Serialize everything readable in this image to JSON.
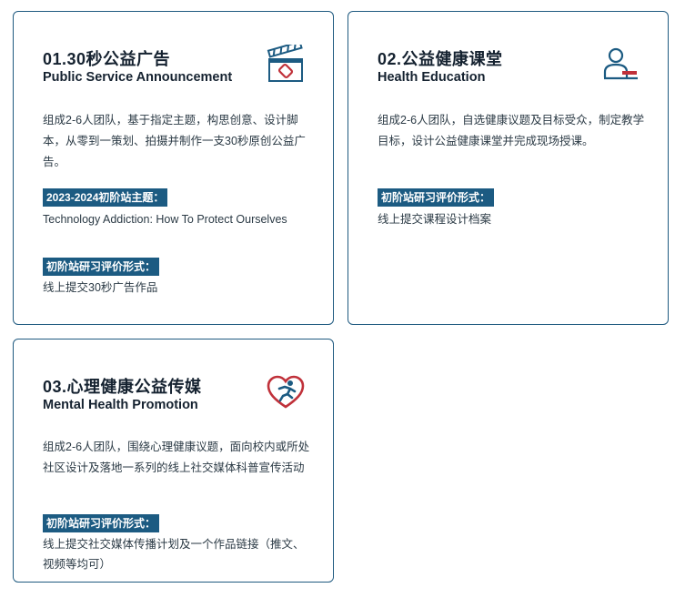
{
  "cards": [
    {
      "title_zh": "01.30秒公益广告",
      "title_en": "Public Service Announcement",
      "icon": "clapperboard-icon",
      "description": "组成2-6人团队，基于指定主题，构思创意、设计脚本，从零到一策划、拍摄并制作一支30秒原创公益广告。",
      "theme_label": "2023-2024初阶站主题：",
      "theme_text": "Technology Addiction: How To Protect Ourselves",
      "eval_label": "初阶站研习评价形式：",
      "eval_text": "线上提交30秒广告作品"
    },
    {
      "title_zh": "02.公益健康课堂",
      "title_en": "Health Education",
      "icon": "lecturer-icon",
      "description": "组成2-6人团队，自选健康议题及目标受众，制定教学目标，设计公益健康课堂并完成现场授课。",
      "eval_label": "初阶站研习评价形式：",
      "eval_text": "线上提交课程设计档案"
    },
    {
      "title_zh": "03.心理健康公益传媒",
      "title_en": "Mental Health Promotion",
      "icon": "heart-runner-icon",
      "description": "组成2-6人团队，围绕心理健康议题，面向校内或所处社区设计及落地一系列的线上社交媒体科普宣传活动",
      "eval_label": "初阶站研习评价形式：",
      "eval_text": "线上提交社交媒体传播计划及一个作品链接（推文、视频等均可）"
    }
  ],
  "colors": {
    "accent": "#1c5b82",
    "border": "#1f5a80",
    "icon_red": "#c0313a"
  }
}
